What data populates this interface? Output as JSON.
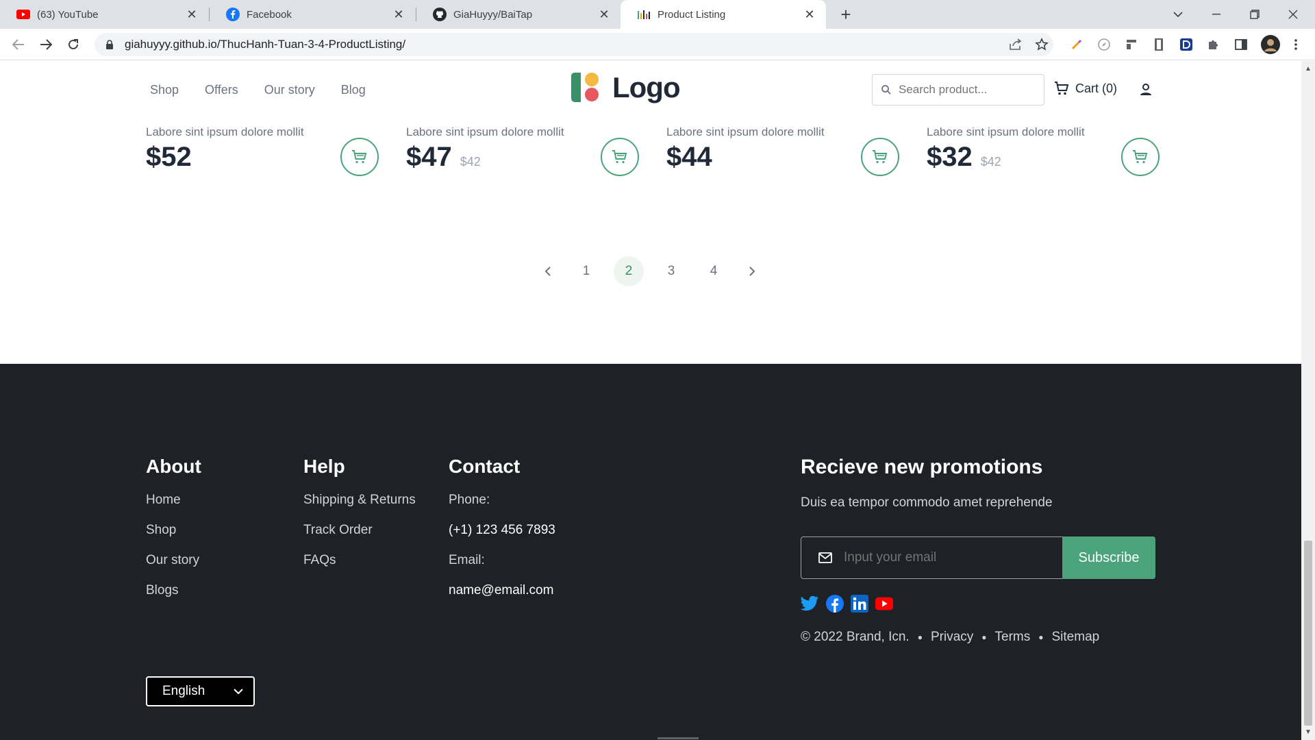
{
  "browser": {
    "tabs": [
      {
        "title": "(63) YouTube",
        "icon": "youtube-icon"
      },
      {
        "title": "Facebook",
        "icon": "facebook-icon"
      },
      {
        "title": "GiaHuyyy/BaiTap",
        "icon": "github-icon"
      },
      {
        "title": "Product Listing",
        "icon": "product-listing-icon",
        "active": true
      }
    ],
    "url": "giahuyyy.github.io/ThucHanh-Tuan-3-4-ProductListing/"
  },
  "header": {
    "nav": [
      "Shop",
      "Offers",
      "Our story",
      "Blog"
    ],
    "logo_text": "Logo",
    "search_placeholder": "Search product...",
    "cart_label": "Cart (0)"
  },
  "products": [
    {
      "name": "Labore sint ipsum dolore mollit",
      "price": "$52",
      "old_price": ""
    },
    {
      "name": "Labore sint ipsum dolore mollit",
      "price": "$47",
      "old_price": "$42"
    },
    {
      "name": "Labore sint ipsum dolore mollit",
      "price": "$44",
      "old_price": ""
    },
    {
      "name": "Labore sint ipsum dolore mollit",
      "price": "$32",
      "old_price": "$42"
    }
  ],
  "pagination": {
    "pages": [
      "1",
      "2",
      "3",
      "4"
    ],
    "current": "2"
  },
  "footer": {
    "about": {
      "title": "About",
      "links": [
        "Home",
        "Shop",
        "Our story",
        "Blogs"
      ]
    },
    "help": {
      "title": "Help",
      "links": [
        "Shipping & Returns",
        "Track Order",
        "FAQs"
      ]
    },
    "contact": {
      "title": "Contact",
      "phone_label": "Phone:",
      "phone": "(+1) 123 456 7893",
      "email_label": "Email:",
      "email": "name@email.com"
    },
    "language": "English",
    "promo": {
      "title": "Recieve new promotions",
      "subtitle": "Duis ea tempor commodo amet reprehende",
      "email_placeholder": "Input your email",
      "button": "Subscribe"
    },
    "copyright": "© 2022 Brand, Icn.",
    "legal_links": [
      "Privacy",
      "Terms",
      "Sitemap"
    ]
  },
  "colors": {
    "accent": "#4aa37b",
    "footer_bg": "#1e2126"
  }
}
